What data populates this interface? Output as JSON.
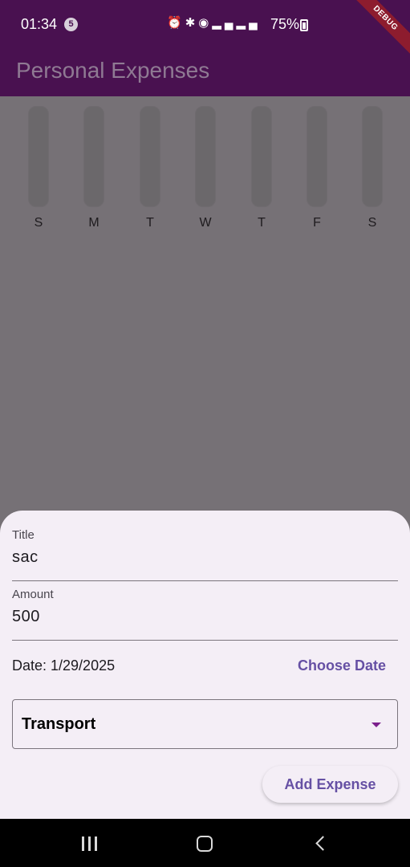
{
  "status_bar": {
    "time": "01:34",
    "notification_count": "5",
    "battery": "75%",
    "icons": [
      "alarm-icon",
      "bluetooth-icon",
      "hotspot-icon",
      "lte-icon",
      "signal-icon",
      "signal-icon"
    ]
  },
  "debug_banner": "DEBUG",
  "app_bar": {
    "title": "Personal Expenses"
  },
  "chart_data": {
    "type": "bar",
    "categories": [
      "S",
      "M",
      "T",
      "W",
      "T",
      "F",
      "S"
    ],
    "values": [
      0,
      0,
      0,
      0,
      0,
      0,
      0
    ]
  },
  "form": {
    "title_label": "Title",
    "title_value": "sac",
    "amount_label": "Amount",
    "amount_value": "500",
    "date_text": "Date: 1/29/2025",
    "choose_date_label": "Choose Date",
    "category_value": "Transport",
    "submit_label": "Add Expense"
  },
  "colors": {
    "app_bar": "#491150",
    "accent": "#6650a4",
    "sheet": "#f4eef6",
    "scrim": "#767176"
  }
}
